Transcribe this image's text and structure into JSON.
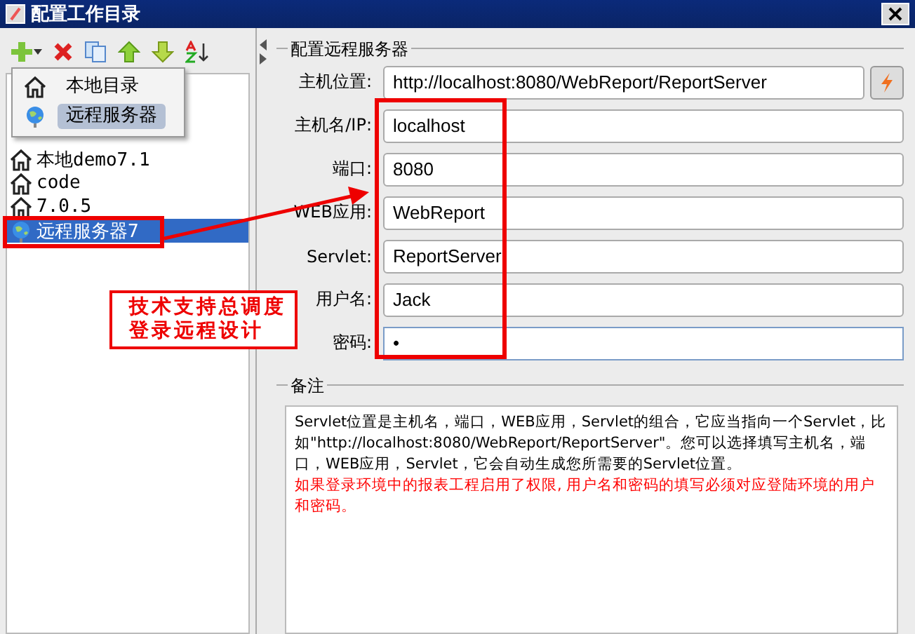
{
  "window": {
    "title": "配置工作目录"
  },
  "popup_menu": {
    "items": [
      {
        "label": "本地目录",
        "kind": "local",
        "selected": false
      },
      {
        "label": "远程服务器",
        "kind": "remote",
        "selected": true
      }
    ]
  },
  "tree": {
    "items": [
      {
        "label": "本地demo7.1",
        "kind": "local",
        "selected": false
      },
      {
        "label": "code",
        "kind": "local",
        "selected": false
      },
      {
        "label": "7.0.5",
        "kind": "local",
        "selected": false
      },
      {
        "label": "远程服务器7",
        "kind": "remote",
        "selected": true
      }
    ]
  },
  "server_group": {
    "title": "配置远程服务器",
    "host_location": {
      "label": "主机位置:",
      "value": "http://localhost:8080/WebReport/ReportServer"
    },
    "fields": [
      {
        "label": "主机名/IP:",
        "value": "localhost",
        "focused": false
      },
      {
        "label": "端口:",
        "value": "8080",
        "focused": false
      },
      {
        "label": "WEB应用:",
        "value": "WebReport",
        "focused": false
      },
      {
        "label": "Servlet:",
        "value": "ReportServer",
        "focused": false
      },
      {
        "label": "用户名:",
        "value": "Jack",
        "focused": false
      },
      {
        "label": "密码:",
        "value": "•",
        "focused": true
      }
    ]
  },
  "note_group": {
    "title": "备注",
    "text": "Servlet位置是主机名，端口，WEB应用，Servlet的组合，它应当指向一个Servlet，比如\"http://localhost:8080/WebReport/ReportServer\"。您可以选择填写主机名，端口，WEB应用，Servlet，它会自动生成您所需要的Servlet位置。",
    "warning": "如果登录环境中的报表工程启用了权限, 用户名和密码的填写必须对应登陆环境的用户和密码。"
  },
  "annotation": {
    "lines": [
      "技术支持总调度",
      "登录远程设计"
    ]
  }
}
